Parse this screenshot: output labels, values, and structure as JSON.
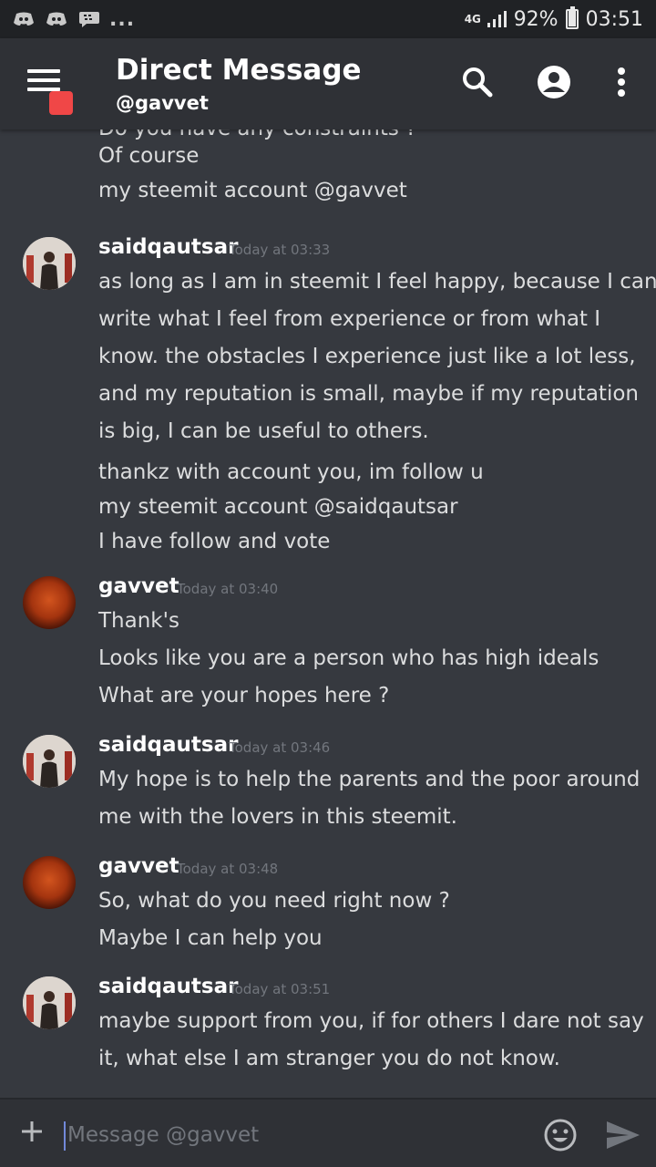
{
  "status_bar": {
    "left_icons": [
      "discord-notification-icon",
      "discord-notification-icon",
      "bbm-notification-icon"
    ],
    "more": "...",
    "network": "4G",
    "battery": "92%",
    "battery_level": 0.92,
    "time": "03:51"
  },
  "header": {
    "title": "Direct Message",
    "subtitle": "@gavvet",
    "icons": [
      "menu-icon",
      "search-icon",
      "profile-icon",
      "more-vertical-icon"
    ]
  },
  "messages": [
    {
      "author": "",
      "timestamp": "",
      "lines": [
        "Do you have any constraints ?",
        "Of course",
        "my steemit account @gavvet"
      ]
    },
    {
      "author": "saidqautsar",
      "timestamp": "Today at 03:33",
      "lines": [
        "as long as I am in steemit I feel happy, because I can",
        "write what I feel from experience or from what I",
        "know. the obstacles I experience just like a lot less,",
        "and my reputation is small, maybe if my reputation",
        "is big, I can be useful to others.",
        "thankz with account you, im follow u",
        "my steemit account @saidqautsar",
        "I have follow and vote"
      ]
    },
    {
      "author": "gavvet",
      "timestamp": "Today at 03:40",
      "lines": [
        "Thank's",
        "Looks like you are a person who has high ideals",
        "What are your hopes here ?"
      ]
    },
    {
      "author": "saidqautsar",
      "timestamp": "Today at 03:46",
      "lines": [
        "My hope is to help the parents and the poor around",
        "me with the lovers in this steemit."
      ]
    },
    {
      "author": "gavvet",
      "timestamp": "Today at 03:48",
      "lines": [
        "So, what do you need right now ?",
        "Maybe I can help you"
      ]
    },
    {
      "author": "saidqautsar",
      "timestamp": "Today at 03:51",
      "lines": [
        "maybe support from you, if for others I dare not say",
        "it, what else I am stranger you do not know."
      ]
    }
  ],
  "composer": {
    "placeholder": "Message @gavvet",
    "icons": [
      "plus-icon",
      "emoji-icon",
      "send-icon"
    ]
  },
  "colors": {
    "background": "#36393f",
    "header": "#2f3136",
    "status_bar": "#202225",
    "unread_badge": "#f04747",
    "timestamp": "#72767d",
    "message_text": "#dcddde"
  }
}
